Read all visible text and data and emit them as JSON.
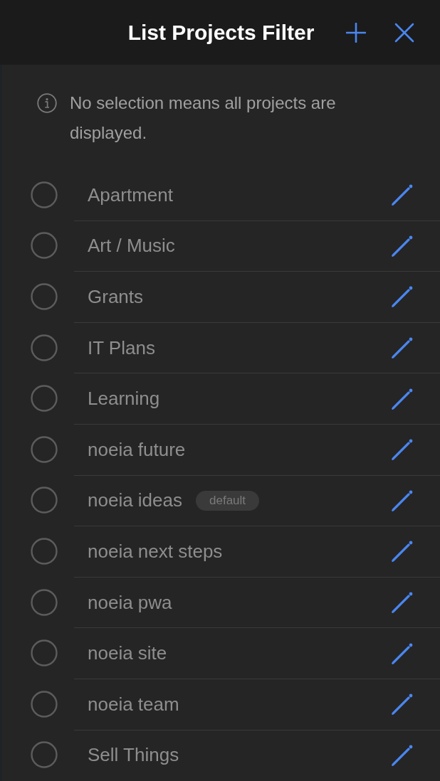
{
  "header": {
    "title": "List Projects Filter"
  },
  "info": {
    "text": "No selection means all projects are displayed."
  },
  "projects": [
    {
      "name": "Apartment",
      "selected": false
    },
    {
      "name": "Art / Music",
      "selected": false
    },
    {
      "name": "Grants",
      "selected": false
    },
    {
      "name": "IT Plans",
      "selected": false
    },
    {
      "name": "Learning",
      "selected": false
    },
    {
      "name": "noeia future",
      "selected": false
    },
    {
      "name": "noeia ideas",
      "selected": false,
      "badge": "default"
    },
    {
      "name": "noeia next steps",
      "selected": false
    },
    {
      "name": "noeia pwa",
      "selected": false
    },
    {
      "name": "noeia site",
      "selected": false
    },
    {
      "name": "noeia team",
      "selected": false
    },
    {
      "name": "Sell Things",
      "selected": false
    }
  ]
}
